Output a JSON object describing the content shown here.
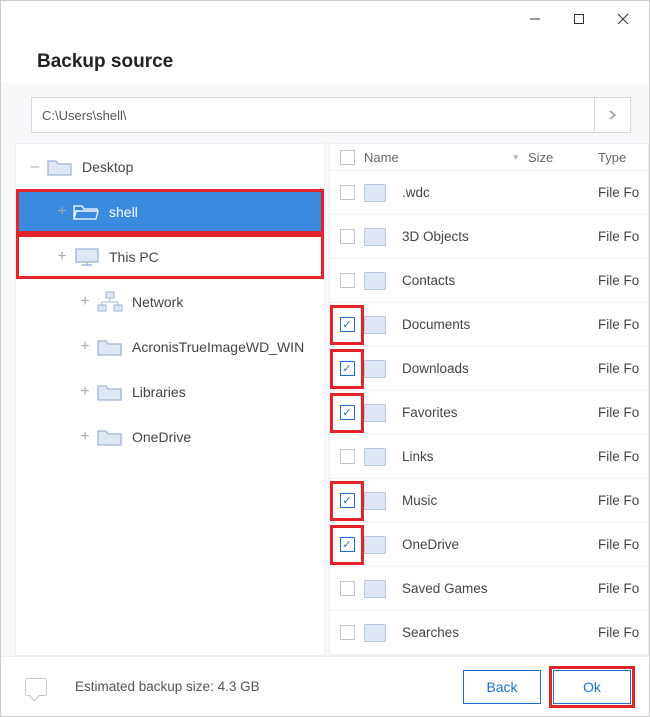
{
  "header": {
    "title": "Backup source"
  },
  "path": {
    "value": "C:\\Users\\shell\\"
  },
  "tree": [
    {
      "label": "Desktop",
      "depth": 0,
      "expander": "–",
      "icon": "folder",
      "selected": false,
      "highlight": false
    },
    {
      "label": "shell",
      "depth": 1,
      "expander": "+",
      "icon": "folder-open",
      "selected": true,
      "highlight": true
    },
    {
      "label": "This PC",
      "depth": 1,
      "expander": "+",
      "icon": "pc",
      "selected": false,
      "highlight": true
    },
    {
      "label": "Network",
      "depth": 2,
      "expander": "+",
      "icon": "network",
      "selected": false,
      "highlight": false
    },
    {
      "label": "AcronisTrueImageWD_WIN",
      "depth": 2,
      "expander": "+",
      "icon": "folder",
      "selected": false,
      "highlight": false
    },
    {
      "label": "Libraries",
      "depth": 2,
      "expander": "+",
      "icon": "folder",
      "selected": false,
      "highlight": false
    },
    {
      "label": "OneDrive",
      "depth": 2,
      "expander": "+",
      "icon": "folder",
      "selected": false,
      "highlight": false
    }
  ],
  "columns": {
    "name": "Name",
    "size": "Size",
    "type": "Type"
  },
  "files": [
    {
      "name": ".wdc",
      "type": "File Fo",
      "checked": false,
      "hl": false
    },
    {
      "name": "3D Objects",
      "type": "File Fo",
      "checked": false,
      "hl": false
    },
    {
      "name": "Contacts",
      "type": "File Fo",
      "checked": false,
      "hl": false
    },
    {
      "name": "Documents",
      "type": "File Fo",
      "checked": true,
      "hl": true
    },
    {
      "name": "Downloads",
      "type": "File Fo",
      "checked": true,
      "hl": true
    },
    {
      "name": "Favorites",
      "type": "File Fo",
      "checked": true,
      "hl": true
    },
    {
      "name": "Links",
      "type": "File Fo",
      "checked": false,
      "hl": false
    },
    {
      "name": "Music",
      "type": "File Fo",
      "checked": true,
      "hl": true
    },
    {
      "name": "OneDrive",
      "type": "File Fo",
      "checked": true,
      "hl": true
    },
    {
      "name": "Saved Games",
      "type": "File Fo",
      "checked": false,
      "hl": false
    },
    {
      "name": "Searches",
      "type": "File Fo",
      "checked": false,
      "hl": false
    }
  ],
  "footer": {
    "estimate": "Estimated backup size: 4.3 GB",
    "back": "Back",
    "ok": "Ok"
  }
}
